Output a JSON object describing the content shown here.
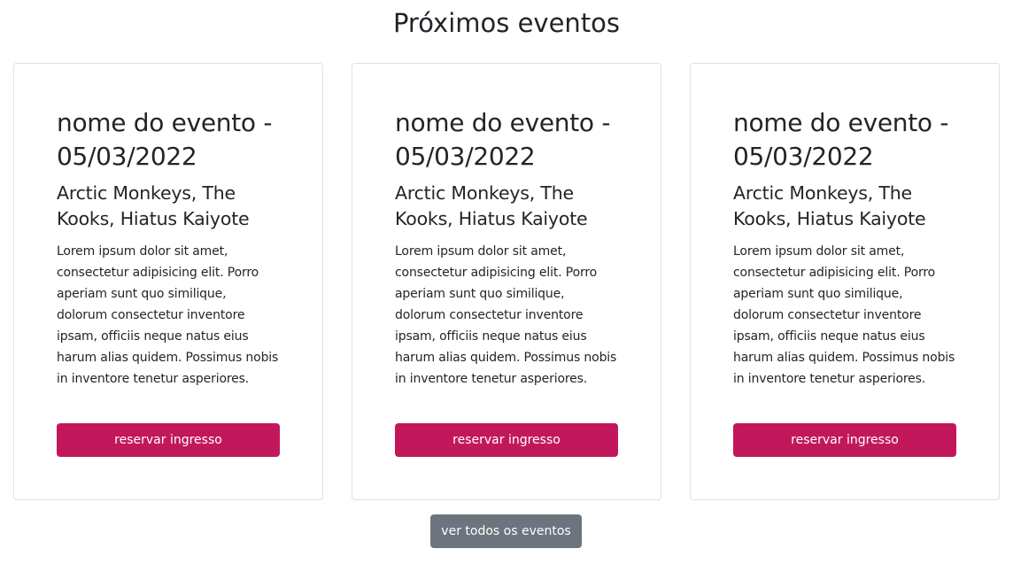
{
  "section": {
    "title": "Próximos eventos"
  },
  "events": [
    {
      "title": "nome do evento -\n05/03/2022",
      "artists": "Arctic Monkeys, The Kooks, Hiatus Kaiyote",
      "description": "Lorem ipsum dolor sit amet, consectetur adipisicing elit. Porro aperiam sunt quo similique, dolorum consectetur inventore ipsam, officiis neque natus eius harum alias quidem. Possimus nobis in inventore tenetur asperiores.",
      "button_label": "reservar ingresso"
    },
    {
      "title": "nome do evento -\n05/03/2022",
      "artists": "Arctic Monkeys, The Kooks, Hiatus Kaiyote",
      "description": "Lorem ipsum dolor sit amet, consectetur adipisicing elit. Porro aperiam sunt quo similique, dolorum consectetur inventore ipsam, officiis neque natus eius harum alias quidem. Possimus nobis in inventore tenetur asperiores.",
      "button_label": "reservar ingresso"
    },
    {
      "title": "nome do evento -\n05/03/2022",
      "artists": "Arctic Monkeys, The Kooks, Hiatus Kaiyote",
      "description": "Lorem ipsum dolor sit amet, consectetur adipisicing elit. Porro aperiam sunt quo similique, dolorum consectetur inventore ipsam, officiis neque natus eius harum alias quidem. Possimus nobis in inventore tenetur asperiores.",
      "button_label": "reservar ingresso"
    }
  ],
  "footer": {
    "all_events_label": "ver todos os eventos"
  },
  "colors": {
    "primary": "#c2185b",
    "secondary": "#6c757d",
    "text": "#212529",
    "card_border": "#e0e0e0"
  }
}
